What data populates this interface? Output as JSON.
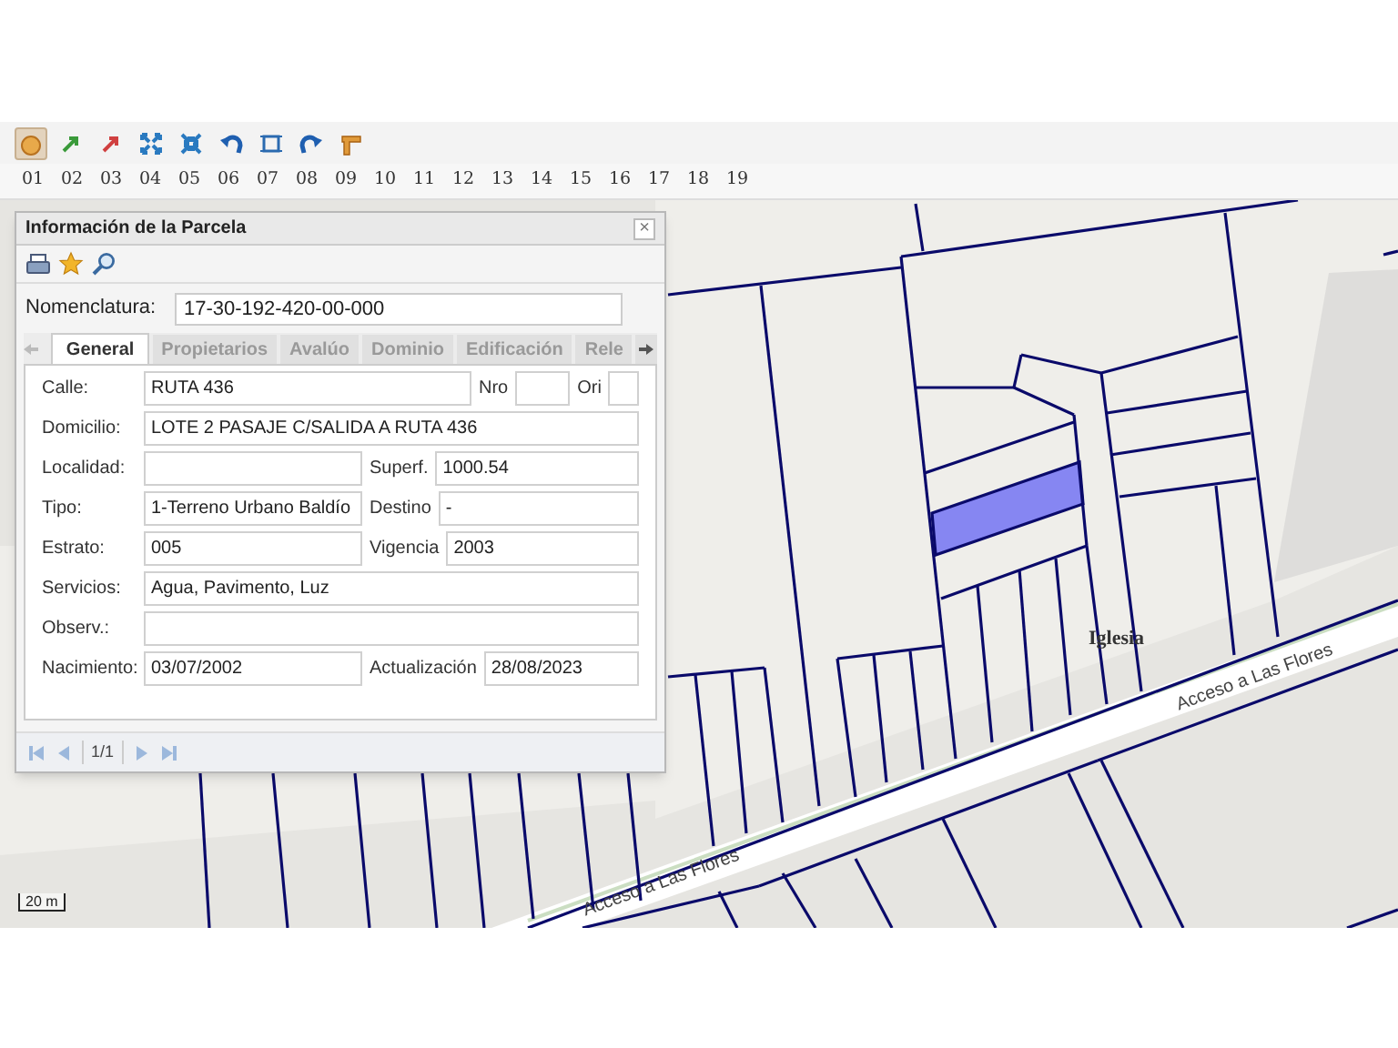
{
  "toolbar": {
    "tools": [
      {
        "kind": "pan",
        "selected": true
      },
      {
        "kind": "zoom-in",
        "selected": false
      },
      {
        "kind": "zoom-out",
        "selected": false
      },
      {
        "kind": "extent-out",
        "selected": false
      },
      {
        "kind": "extent-in",
        "selected": false
      },
      {
        "kind": "undo",
        "selected": false
      },
      {
        "kind": "box",
        "selected": false
      },
      {
        "kind": "redo",
        "selected": false
      },
      {
        "kind": "measure",
        "selected": false
      }
    ],
    "numbers": [
      "01",
      "02",
      "03",
      "04",
      "05",
      "06",
      "07",
      "08",
      "09",
      "10",
      "11",
      "12",
      "13",
      "14",
      "15",
      "16",
      "17",
      "18",
      "19"
    ]
  },
  "dialog": {
    "title": "Información de la Parcela",
    "close": "×",
    "actions": [
      {
        "kind": "print"
      },
      {
        "kind": "star"
      },
      {
        "kind": "search"
      }
    ],
    "nomenclatura": {
      "label": "Nomenclatura:",
      "value": "17-30-192-420-00-000"
    },
    "tabs": [
      {
        "label": "General",
        "selected": true
      },
      {
        "label": "Propietarios",
        "selected": false
      },
      {
        "label": "Avalúo",
        "selected": false
      },
      {
        "label": "Dominio",
        "selected": false
      },
      {
        "label": "Edificación",
        "selected": false
      },
      {
        "label": "Rele",
        "selected": false
      }
    ],
    "rows": [
      [
        {
          "label": "Calle:",
          "value": "RUTA 436"
        },
        {
          "label": "Nro"
        },
        {
          "label": "Ori"
        }
      ],
      [
        {
          "label": "Domicilio:",
          "value": "LOTE 2  PASAJE C/SALIDA A RUTA  436"
        }
      ],
      [
        {
          "label": "Localidad:"
        },
        {
          "label": "Superf.",
          "value": "1000.54"
        }
      ],
      [
        {
          "label": "Tipo:",
          "value": "1-Terreno Urbano Baldío"
        },
        {
          "label": "Destino",
          "value": "-"
        }
      ],
      [
        {
          "label": "Estrato:",
          "value": "005"
        },
        {
          "label": "Vigencia",
          "value": "2003"
        }
      ],
      [
        {
          "label": "Servicios:",
          "value": "Agua, Pavimento, Luz"
        }
      ],
      [
        {
          "label": "Observ.:"
        }
      ],
      [
        {
          "label": "Nacimiento:",
          "value": "03/07/2002"
        },
        {
          "label": "Actualización",
          "value": "28/08/2023"
        }
      ]
    ],
    "pager": "1/1"
  },
  "map": {
    "labels": [
      {
        "kind": "place",
        "text": "Iglesia"
      },
      {
        "kind": "road-right",
        "text": "Acceso a Las Flores"
      },
      {
        "kind": "road-left",
        "text": "Acceso a Las Flores"
      }
    ],
    "scale": "20 m"
  }
}
